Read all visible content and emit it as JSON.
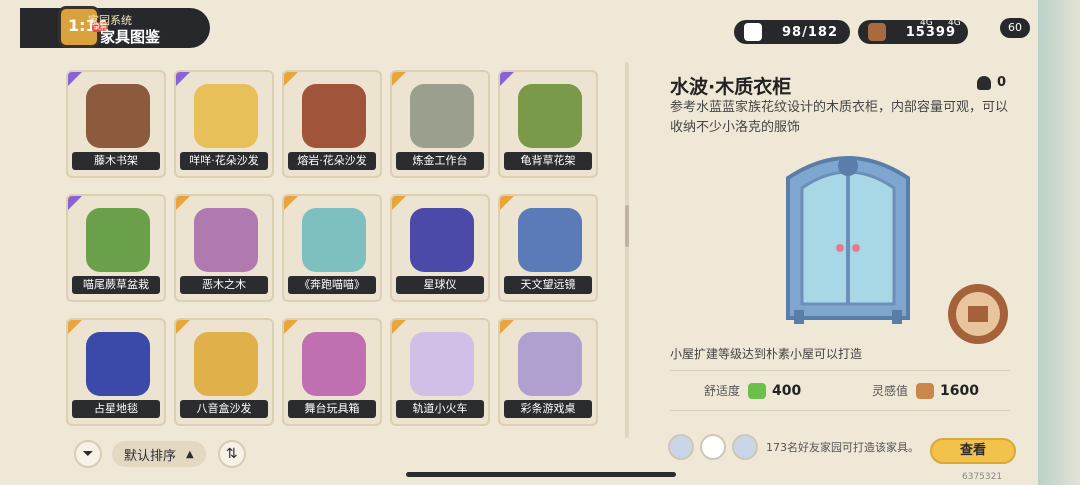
{
  "header": {
    "subtitle": "家园系统",
    "title": "家具图鉴",
    "clock": "1:14",
    "rec_badge": "录屏",
    "collection_count": "98/182",
    "currency_value": "15399",
    "battery": "60",
    "network_1": "4G",
    "network_2": "4G"
  },
  "grid": {
    "items": [
      {
        "label": "藤木书架",
        "rarity": "purple"
      },
      {
        "label": "咩咩·花朵沙发",
        "rarity": "purple"
      },
      {
        "label": "熔岩·花朵沙发",
        "rarity": "gold"
      },
      {
        "label": "炼金工作台",
        "rarity": "gold"
      },
      {
        "label": "龟背草花架",
        "rarity": "purple"
      },
      {
        "label": "喵尾蕨草盆栽",
        "rarity": "purple"
      },
      {
        "label": "恶木之木",
        "rarity": "gold"
      },
      {
        "label": "《奔跑喵喵》",
        "rarity": "gold"
      },
      {
        "label": "星球仪",
        "rarity": "gold"
      },
      {
        "label": "天文望远镜",
        "rarity": "gold"
      },
      {
        "label": "占星地毯",
        "rarity": "gold"
      },
      {
        "label": "八音盒沙发",
        "rarity": "gold"
      },
      {
        "label": "舞台玩具箱",
        "rarity": "gold"
      },
      {
        "label": "轨道小火车",
        "rarity": "gold"
      },
      {
        "label": "彩条游戏桌",
        "rarity": "gold"
      }
    ]
  },
  "controls": {
    "sort_label": "默认排序"
  },
  "detail": {
    "title": "水波·木质衣柜",
    "owned": "0",
    "description": "参考水蓝蓝家族花纹设计的木质衣柜，内部容量可观，可以收纳不少小洛克的服饰",
    "requirement": "小屋扩建等级达到朴素小屋可以打造",
    "comfort_label": "舒适度",
    "comfort_value": "400",
    "inspiration_label": "灵感值",
    "inspiration_value": "1600",
    "friends_text": "173名好友家园可打造该家具。",
    "view_button": "查看",
    "uid": "6375321"
  },
  "colors": {
    "purple": "#8a62d8",
    "gold": "#e9a43a",
    "dark": "#2b2c30",
    "panel": "#efe8d7"
  }
}
